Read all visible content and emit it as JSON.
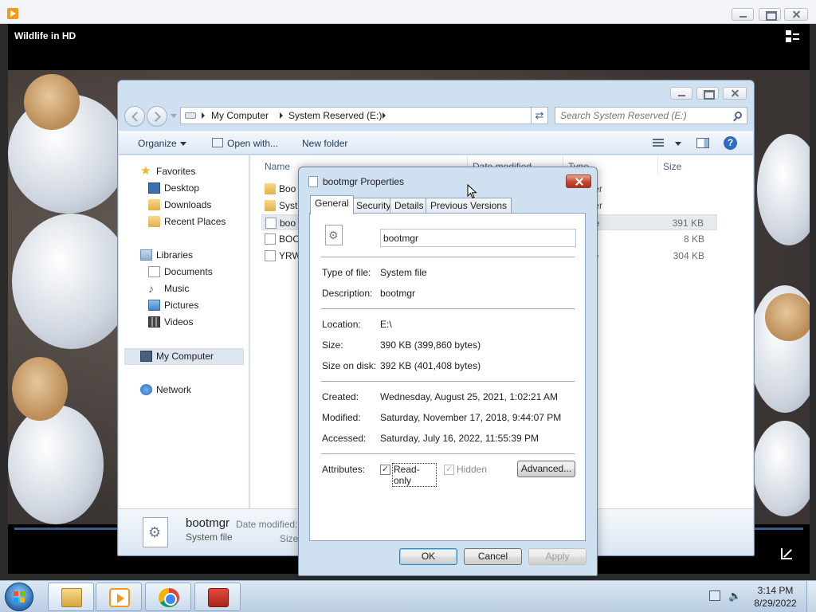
{
  "media_player": {
    "title": "Wildlife in HD"
  },
  "explorer": {
    "breadcrumb": [
      "My Computer",
      "System Reserved (E:)"
    ],
    "search_placeholder": "Search System Reserved (E:)",
    "toolbar": {
      "organize": "Organize",
      "open_with": "Open with...",
      "new_folder": "New folder"
    },
    "nav": {
      "favorites": "Favorites",
      "desktop": "Desktop",
      "downloads": "Downloads",
      "recent_places": "Recent Places",
      "libraries": "Libraries",
      "documents": "Documents",
      "music": "Music",
      "pictures": "Pictures",
      "videos": "Videos",
      "my_computer": "My Computer",
      "network": "Network"
    },
    "columns": {
      "name": "Name",
      "date_modified": "Date modified",
      "type": "Type",
      "size": "Size"
    },
    "files": [
      {
        "name": "Boo",
        "type": "lder",
        "size": ""
      },
      {
        "name": "Syst",
        "type": "lder",
        "size": ""
      },
      {
        "name": "boo",
        "type": "file",
        "size": "391 KB"
      },
      {
        "name": "BOC",
        "type": "e",
        "size": "8 KB"
      },
      {
        "name": "YRW",
        "type": "file",
        "size": "304 KB"
      }
    ],
    "details": {
      "name": "bootmgr",
      "type": "System file",
      "date_label": "Date modified:",
      "size_label": "Size:"
    }
  },
  "properties": {
    "title": "bootmgr Properties",
    "tabs": [
      "General",
      "Security",
      "Details",
      "Previous Versions"
    ],
    "file_name": "bootmgr",
    "labels": {
      "type": "Type of file:",
      "description": "Description:",
      "location": "Location:",
      "size": "Size:",
      "size_on_disk": "Size on disk:",
      "created": "Created:",
      "modified": "Modified:",
      "accessed": "Accessed:",
      "attributes": "Attributes:"
    },
    "values": {
      "type": "System file",
      "description": "bootmgr",
      "location": "E:\\",
      "size": "390 KB (399,860 bytes)",
      "size_on_disk": "392 KB (401,408 bytes)",
      "created": "Wednesday, August 25, 2021, 1:02:21 AM",
      "modified": "Saturday, November 17, 2018, 9:44:07 PM",
      "accessed": "Saturday, July 16, 2022, 11:55:39 PM"
    },
    "attributes": {
      "read_only": "Read-only",
      "hidden": "Hidden",
      "advanced": "Advanced..."
    },
    "buttons": {
      "ok": "OK",
      "cancel": "Cancel",
      "apply": "Apply"
    }
  },
  "taskbar": {
    "time": "3:14 PM",
    "date": "8/29/2022"
  }
}
